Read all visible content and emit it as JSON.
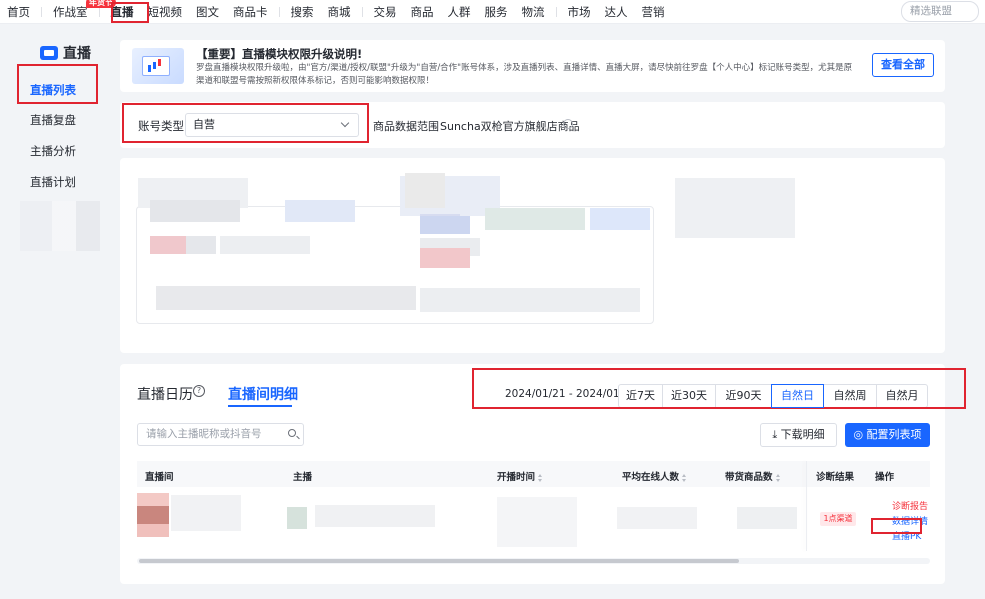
{
  "topnav": {
    "items": [
      "首页",
      "作战室",
      "直播",
      "短视频",
      "图文",
      "商品卡",
      "搜索",
      "商城",
      "交易",
      "商品",
      "人群",
      "服务",
      "物流",
      "市场",
      "达人",
      "营销"
    ],
    "badge": "年货节",
    "search_placeholder": "精选联盟"
  },
  "sidebar": {
    "title": "直播",
    "items": [
      "直播列表",
      "直播复盘",
      "主播分析",
      "直播计划"
    ]
  },
  "notice": {
    "title": "【重要】直播模块权限升级说明!",
    "body": "罗盘直播模块权限升级啦，由\"官方/渠道/授权/联盟\"升级为\"自营/合作\"账号体系，涉及直播列表、直播详情、直播大屏，请尽快前往罗盘【个人中心】标记账号类型，尤其是原渠道和联盟号需按照新权限体系标记，否则可能影响数据权限！",
    "button": "查看全部"
  },
  "filter": {
    "account_type_label": "账号类型",
    "account_type_value": "自营",
    "scope_label": "商品数据范围",
    "scope_value": "Suncha双枪官方旗舰店商品"
  },
  "detail": {
    "tab_calendar": "直播日历",
    "tab_detail": "直播间明细",
    "date_range": "2024/01/21 - 2024/01/21",
    "periods": [
      "近7天",
      "近30天",
      "近90天",
      "自然日",
      "自然周",
      "自然月"
    ],
    "active_period": "自然日",
    "search_placeholder": "请输入主播昵称或抖音号",
    "download_label": "下载明细",
    "config_label": "配置列表项",
    "columns": [
      "直播间",
      "主播",
      "开播时间",
      "平均在线人数",
      "带货商品数",
      "诊断结果",
      "操作"
    ],
    "row": {
      "diagnosis_tag": "1点渠道",
      "actions": [
        "诊断报告",
        "数据详情",
        "直播PK"
      ]
    }
  },
  "colors": {
    "accent": "#1966ff",
    "highlight": "#e02430",
    "danger": "#f5323c"
  }
}
